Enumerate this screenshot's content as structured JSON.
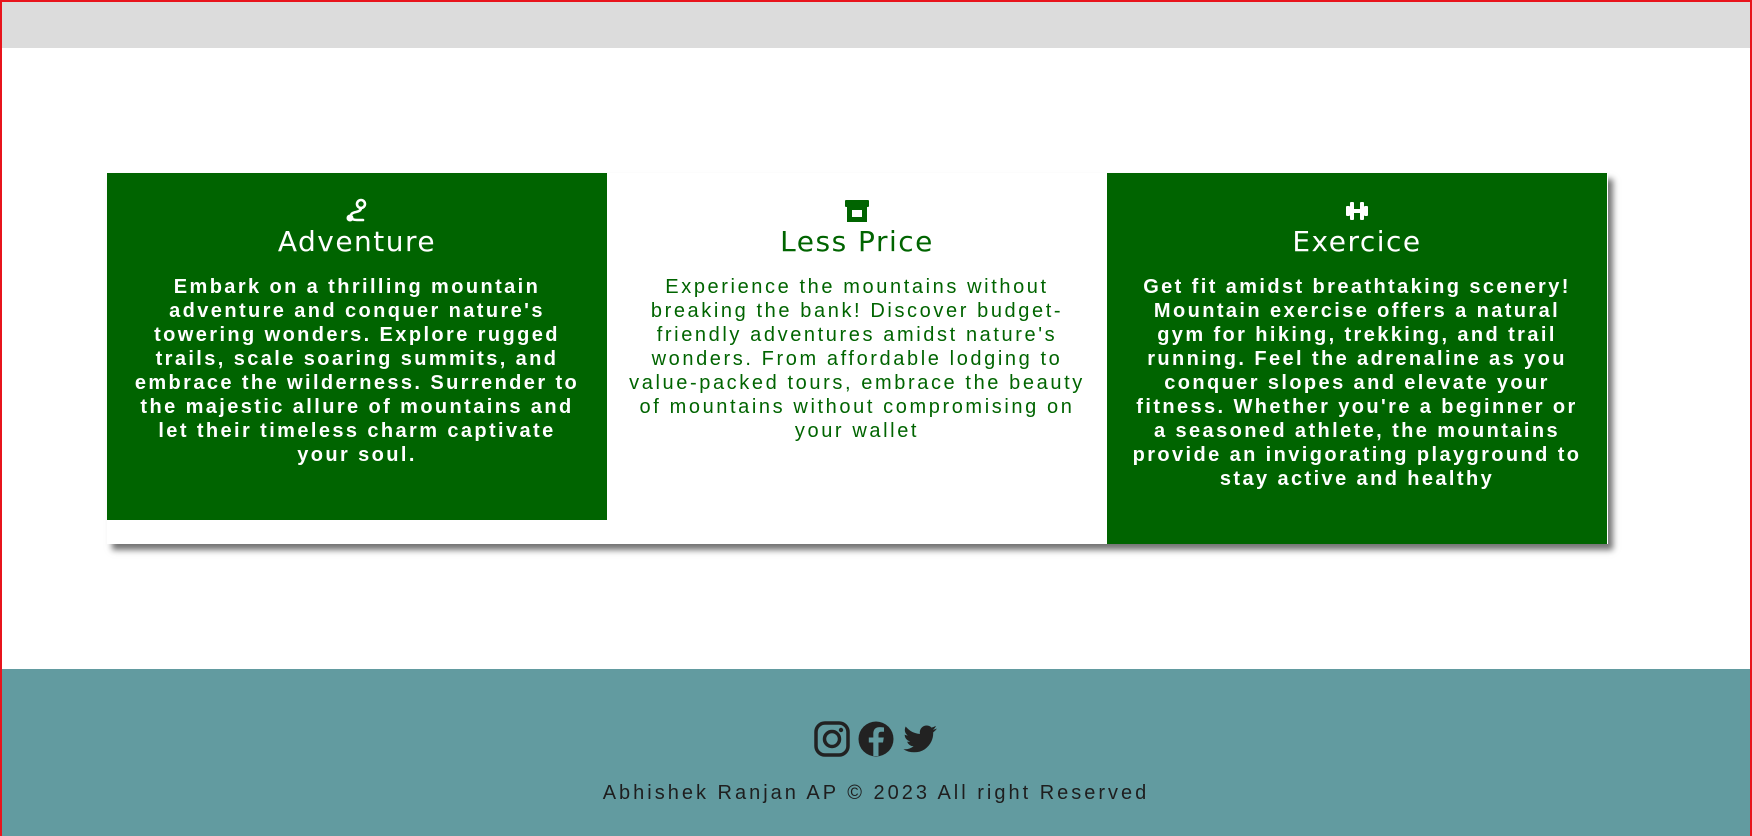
{
  "colors": {
    "card_green": "#006400",
    "footer_teal": "#629ba0",
    "top_strip": "#dcdcdc"
  },
  "cards": [
    {
      "icon": "route-icon",
      "title": "Adventure",
      "text": "Embark on a thrilling mountain adventure and conquer nature's towering wonders. Explore rugged trails, scale soaring summits, and embrace the wilderness. Surrender to the majestic allure of mountains and let their timeless charm captivate your soul."
    },
    {
      "icon": "store-icon",
      "title": "Less Price",
      "text": "Experience the mountains without breaking the bank! Discover budget-friendly adventures amidst nature's wonders. From affordable lodging to value-packed tours, embrace the beauty of mountains without compromising on your wallet"
    },
    {
      "icon": "dumbbell-icon",
      "title": "Exercice",
      "text": "Get fit amidst breathtaking scenery! Mountain exercise offers a natural gym for hiking, trekking, and trail running. Feel the adrenaline as you conquer slopes and elevate your fitness. Whether you're a beginner or a seasoned athlete, the mountains provide an invigorating playground to stay active and healthy"
    }
  ],
  "footer": {
    "social_icons": [
      "instagram-icon",
      "facebook-icon",
      "twitter-icon"
    ],
    "copyright": "Abhishek Ranjan AP © 2023 All right Reserved"
  }
}
